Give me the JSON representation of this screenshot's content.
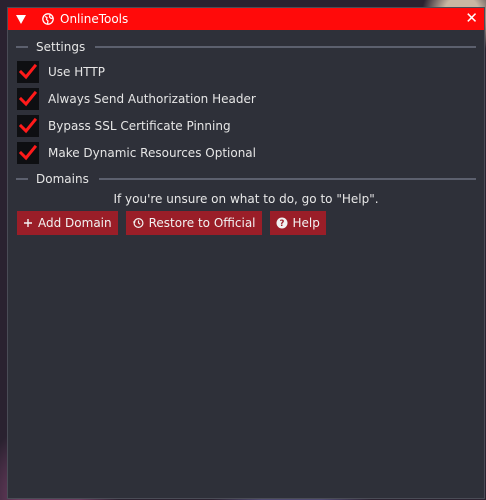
{
  "window": {
    "title": "OnlineTools"
  },
  "settings": {
    "header": "Settings",
    "options": [
      {
        "label": "Use HTTP",
        "checked": true
      },
      {
        "label": "Always Send Authorization Header",
        "checked": true
      },
      {
        "label": "Bypass SSL Certificate Pinning",
        "checked": true
      },
      {
        "label": "Make Dynamic Resources Optional",
        "checked": true
      }
    ]
  },
  "domains": {
    "header": "Domains",
    "info": "If you're unsure on what to do, go to \"Help\".",
    "buttons": [
      {
        "label": "Add Domain",
        "icon": "plus-icon"
      },
      {
        "label": "Restore to Official",
        "icon": "history-icon"
      },
      {
        "label": "Help",
        "icon": "question-icon"
      }
    ]
  },
  "colors": {
    "titlebar": "#ff0a0a",
    "panel": "#2e3039",
    "button": "#9a1e28",
    "check": "#ff1a1a"
  }
}
